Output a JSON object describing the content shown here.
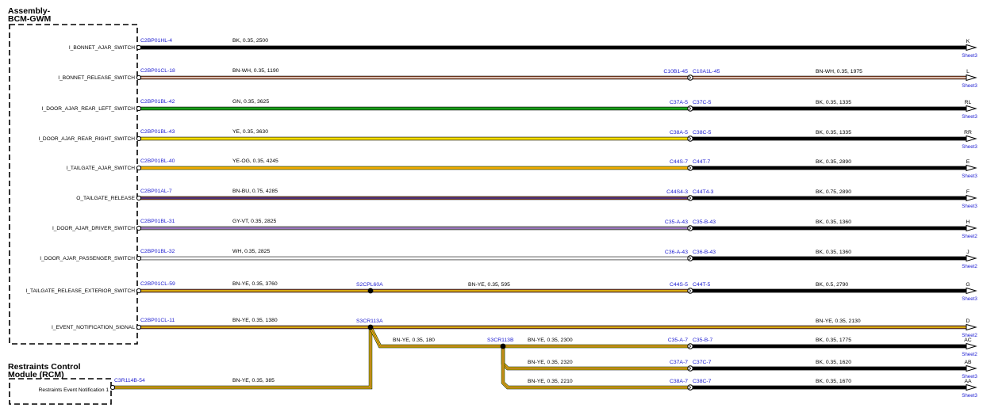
{
  "modules": {
    "bcm": {
      "title_line1": "Assembly-",
      "title_line2": "BCM-GWM"
    },
    "rcm": {
      "title_line1": "Restraints Control",
      "title_line2": "Module (RCM)"
    }
  },
  "colors": {
    "BK": "#000000",
    "BN": "#a0522d",
    "WH": "#ffffff",
    "GN": "#1a9e1a",
    "YE": "#f5de00",
    "OG": "#f08a00",
    "BU": "#1c1ca8",
    "GY": "#9a9a9a",
    "VT": "#9a5cd6",
    "link": "#1a1ad0"
  },
  "circuits": [
    {
      "id": "bonnet-ajar",
      "pin": "I_BONNET_AJAR_SWITCH",
      "src": "C2BP01HL-4",
      "spec1": "BK, 0.35, 2500",
      "c1": "BK",
      "c2": null,
      "inline": null,
      "letter": "K",
      "sheet": "Sheet3"
    },
    {
      "id": "bonnet-release",
      "pin": "I_BONNET_RELEASE_SWITCH",
      "src": "C2BP01CL-18",
      "spec1": "BN-WH, 0.35, 1190",
      "c1": "BN",
      "c2": "WH",
      "inline": {
        "left": "C10B1-45",
        "right": "C10A1L-45",
        "spec2": "BN-WH, 0.35, 1975",
        "c1": "BN",
        "c2": "WH"
      },
      "letter": "L",
      "sheet": "Sheet3"
    },
    {
      "id": "door-rear-left",
      "pin": "I_DOOR_AJAR_REAR_LEFT_SWITCH",
      "src": "C2BP01BL-42",
      "spec1": "GN, 0.35, 3625",
      "c1": "GN",
      "c2": null,
      "inline": {
        "left": "C37A-5",
        "right": "C37C-5",
        "spec2": "BK, 0.35, 1335",
        "c1": "BK",
        "c2": null
      },
      "letter": "RL",
      "sheet": "Sheet3"
    },
    {
      "id": "door-rear-right",
      "pin": "I_DOOR_AJAR_REAR_RIGHT_SWITCH",
      "src": "C2BP01BL-43",
      "spec1": "YE, 0.35, 3630",
      "c1": "YE",
      "c2": null,
      "inline": {
        "left": "C38A-5",
        "right": "C38C-5",
        "spec2": "BK, 0.35, 1335",
        "c1": "BK",
        "c2": null
      },
      "letter": "RR",
      "sheet": "Sheet3"
    },
    {
      "id": "tailgate-ajar",
      "pin": "I_TAILGATE_AJAR_SWITCH",
      "src": "C2BP01BL-40",
      "spec1": "YE-OG, 0.35, 4245",
      "c1": "YE",
      "c2": "OG",
      "inline": {
        "left": "C44S-7",
        "right": "C44T-7",
        "spec2": "BK, 0.35, 2890",
        "c1": "BK",
        "c2": null
      },
      "letter": "E",
      "sheet": "Sheet3"
    },
    {
      "id": "tailgate-release",
      "pin": "O_TAILGATE_RELEASE",
      "src": "C2BP01AL-7",
      "spec1": "BN-BU, 0.75, 4285",
      "c1": "BN",
      "c2": "BU",
      "inline": {
        "left": "C44S4-3",
        "right": "C44T4-3",
        "spec2": "BK, 0.75, 2890",
        "c1": "BK",
        "c2": null
      },
      "letter": "F",
      "sheet": "Sheet3"
    },
    {
      "id": "door-driver",
      "pin": "I_DOOR_AJAR_DRIVER_SWITCH",
      "src": "C2BP01BL-31",
      "spec1": "GY-VT, 0.35, 2825",
      "c1": "GY",
      "c2": "VT",
      "inline": {
        "left": "C35-A-43",
        "right": "C35-B-43",
        "spec2": "BK, 0.35, 1360",
        "c1": "BK",
        "c2": null
      },
      "letter": "H",
      "sheet": "Sheet2"
    },
    {
      "id": "door-passenger",
      "pin": "I_DOOR_AJAR_PASSENGER_SWITCH",
      "src": "C2BP01BL-32",
      "spec1": "WH, 0.35, 2825",
      "c1": "WH",
      "c2": null,
      "inline": {
        "left": "C36-A-43",
        "right": "C36-B-43",
        "spec2": "BK, 0.35, 1360",
        "c1": "BK",
        "c2": null
      },
      "letter": "J",
      "sheet": "Sheet2"
    },
    {
      "id": "tailgate-release-ext",
      "pin": "I_TAILGATE_RELEASE_EXTERIOR_SWITCH",
      "src": "C2BP01CL-59",
      "spec1": "BN-YE, 0.35, 3760",
      "c1": "BN",
      "c2": "YE",
      "splice": {
        "label": "S2CPL60A",
        "spec": "BN-YE, 0.35, 595"
      },
      "inline": {
        "left": "C44S-5",
        "right": "C44T-5",
        "spec2": "BK, 0.5, 2790",
        "c1": "BK",
        "c2": null
      },
      "letter": "G",
      "sheet": "Sheet3"
    },
    {
      "id": "event-notification",
      "pin": "I_EVENT_NOTIFICATION_SIGNAL",
      "src": "C2BP01CL-11",
      "spec1": "BN-YE, 0.35, 1380",
      "c1": "BN",
      "c2": "YE",
      "splice": {
        "label": "S3CR113A",
        "spec": "BN-YE, 0.35, 2130"
      },
      "inline": null,
      "letter": "D",
      "sheet": "Sheet2"
    }
  ],
  "splice_branch": {
    "label": "S3CR113B",
    "link_spec": "BN-YE, 0.35, 180"
  },
  "branches": [
    {
      "id": "branch-ac",
      "spec1": "BN-YE, 0.35, 2300",
      "left": "C35-A-7",
      "right": "C35-B-7",
      "spec2": "BK, 0.35, 1775",
      "letter": "AC",
      "sheet": "Sheet2"
    },
    {
      "id": "branch-ab",
      "spec1": "BN-YE, 0.35, 2320",
      "left": "C37A-7",
      "right": "C37C-7",
      "spec2": "BK, 0.35, 1620",
      "letter": "AB",
      "sheet": "Sheet3"
    },
    {
      "id": "branch-aa",
      "spec1": "BN-YE, 0.35, 2210",
      "left": "C38A-7",
      "right": "C38C-7",
      "spec2": "BK, 0.35, 1670",
      "letter": "AA",
      "sheet": "Sheet3"
    }
  ],
  "rcm_pin": {
    "pin": "Restraints Event Notification 1",
    "src": "C3R114B-54",
    "spec": "BN-YE, 0.35, 385"
  }
}
